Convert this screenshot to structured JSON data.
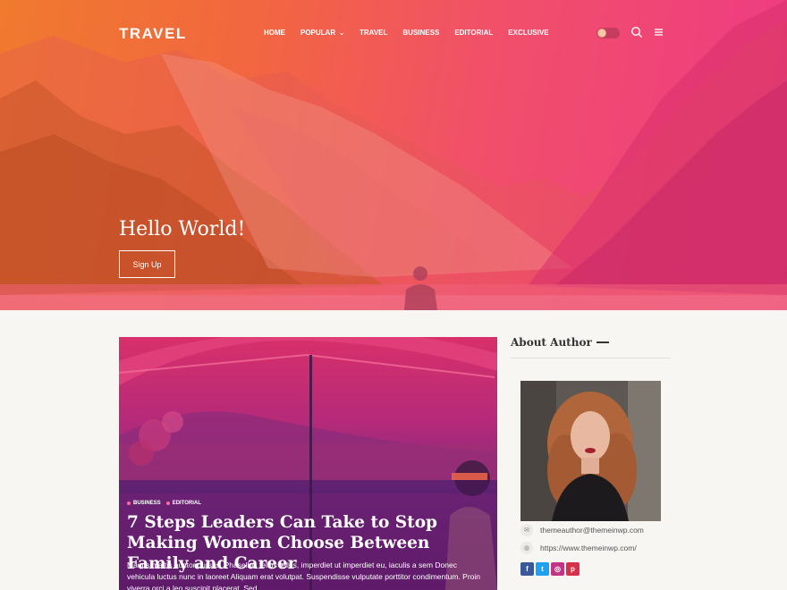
{
  "header": {
    "brand": "TRAVEL",
    "nav": [
      {
        "label": "HOME"
      },
      {
        "label": "POPULAR"
      },
      {
        "label": "TRAVEL"
      },
      {
        "label": "BUSINESS"
      },
      {
        "label": "EDITORIAL"
      },
      {
        "label": "EXCLUSIVE"
      }
    ],
    "icons": {
      "search": "search-icon",
      "menu": "hamburger-menu-icon",
      "toggle": "dark-mode-toggle"
    }
  },
  "hero": {
    "title": "Hello World!",
    "button_label": "Sign Up"
  },
  "post": {
    "categories": [
      "BUSINESS",
      "EDITORIAL"
    ],
    "title": "7 Steps Leaders Can Take to Stop Making Women Choose Between Family and Career",
    "excerpt": "Mauris mattis auctor cursus. Phasellus tellus tellus, imperdiet ut imperdiet eu, iaculis a sem Donec vehicula luctus nunc in laoreet Aliquam erat volutpat. Suspendisse vulputate porttitor condimentum. Proin viverra orci a leo suscipit placerat. Sed..."
  },
  "sidebar": {
    "widget_title": "About Author",
    "email": "themeauthor@themeinwp.com",
    "website": "https://www.themeinwp.com/",
    "socials": [
      {
        "name": "facebook",
        "glyph": "f",
        "color": "#3b5998"
      },
      {
        "name": "twitter",
        "glyph": "t",
        "color": "#1da1f2"
      },
      {
        "name": "instagram",
        "glyph": "◎",
        "color": "#c13584"
      },
      {
        "name": "pinterest",
        "glyph": "p",
        "color": "#d6304a"
      }
    ]
  },
  "colors": {
    "hero_gradient_start": "#f07a2e",
    "hero_gradient_end": "#ee3a85",
    "page_background": "#f8f6f3"
  }
}
